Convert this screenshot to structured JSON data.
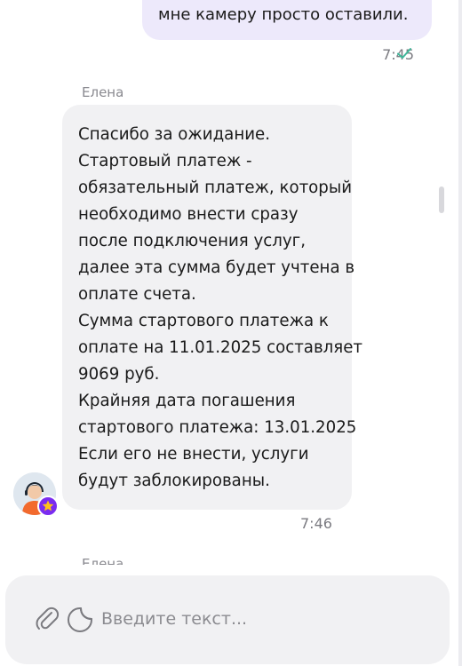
{
  "outgoing_message": {
    "text": "мне камеру просто оставили.",
    "time": "7:45",
    "status_icon": "check-icon"
  },
  "incoming_message": {
    "sender": "Елена",
    "lines": [
      "Спасибо за ожидание.",
      "Стартовый платеж -",
      "обязательный платеж, который",
      "необходимо внести сразу",
      "после подключения услуг,",
      "далее эта сумма будет учтена в",
      "оплате счета.",
      "Сумма стартового платежа к",
      "оплате на 11.01.2025 составляет",
      "9069 руб.",
      "Крайняя дата погашения",
      "стартового платежа: 13.01.2025",
      "Если его не внести, услуги",
      "будут заблокированы."
    ],
    "time": "7:46"
  },
  "next_message": {
    "sender": "Елена"
  },
  "composer": {
    "placeholder": "Введите текст..."
  },
  "colors": {
    "outgoing_bubble": "#ede9fb",
    "incoming_bubble": "#f1f1f3",
    "check": "#3fb89a",
    "badge": "#7a2cf0"
  }
}
